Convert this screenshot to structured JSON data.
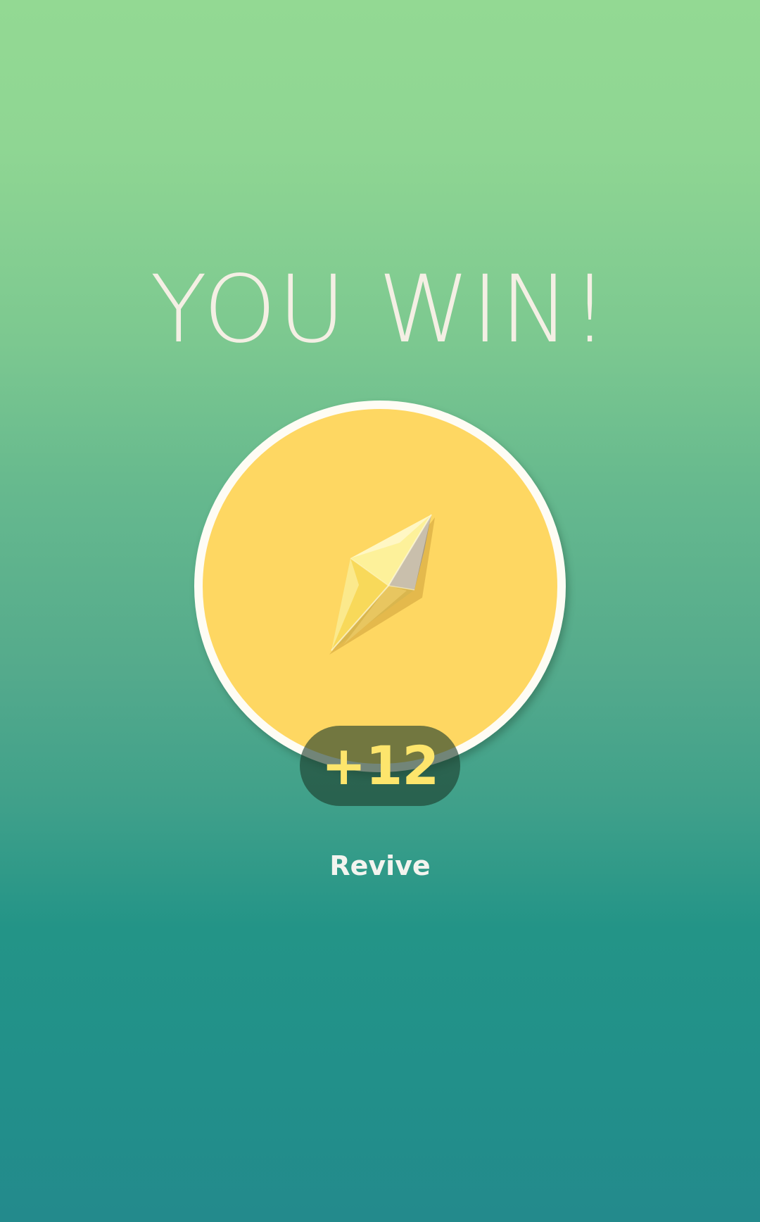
{
  "screen": {
    "title": "YOU WIN!",
    "background_top_color": "#93d993",
    "background_bottom_color": "#238a8c"
  },
  "reward": {
    "icon": "revive-crystal-icon",
    "circle_color": "#fed762",
    "quantity": "+12",
    "quantity_color": "#fde56c",
    "item_name": "Revive"
  }
}
